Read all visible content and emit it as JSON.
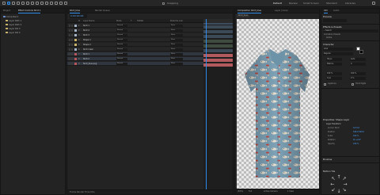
{
  "toolbar": {
    "tool_count": 14,
    "labels": [
      "Snapping",
      "Default",
      "Review",
      "Small Screen",
      "Standard",
      "Libraries"
    ],
    "current_workspace": "Default"
  },
  "project": {
    "tabs": [
      "Project",
      "Effect Controls Shirt 1"
    ],
    "items": [
      {
        "name": "Comp Rat 1",
        "type": "Composition",
        "color": "#6b8cc9"
      },
      {
        "name": "Layer Path 1",
        "type": "Shape",
        "color": "#c9b36b"
      },
      {
        "name": "Layer Path 2",
        "type": "Shape",
        "color": "#c9b36b"
      },
      {
        "name": "Layer Pat 3",
        "type": "Shape",
        "color": "#c9b36b"
      },
      {
        "name": "Layer Pat 4",
        "type": "Shape",
        "color": "#c9b36b"
      }
    ]
  },
  "timeline": {
    "tabs": [
      "Shirt_blue",
      "Render Queue"
    ],
    "timecode": "0:00:00:00",
    "headers": [
      "#",
      "Layer Name",
      "Mode",
      "T",
      "TrkMat",
      "Parent & Link"
    ],
    "layers": [
      {
        "num": "1",
        "name": "Shirt 1",
        "mode": "Normal",
        "parent": "None",
        "color": "#a3b4c8",
        "bar": "#3c4a57",
        "selected": false
      },
      {
        "num": "2",
        "name": "Shirt 2",
        "mode": "Normal",
        "parent": "None",
        "color": "#a3b4c8",
        "bar": "#3c4a57",
        "selected": false
      },
      {
        "num": "3",
        "name": "Shirt 3",
        "mode": "Normal",
        "parent": "None",
        "color": "#a3b4c8",
        "bar": "#3c4a57",
        "selected": false
      },
      {
        "num": "4",
        "name": "Shape 1",
        "mode": "Normal",
        "parent": "None",
        "color": "#c9b36b",
        "bar": "#3f4b3f",
        "selected": false
      },
      {
        "num": "5",
        "name": "Shape 2",
        "mode": "Normal",
        "parent": "None",
        "color": "#c9b36b",
        "bar": "#3f4b3f",
        "selected": false
      },
      {
        "num": "6",
        "name": "Shirt mask",
        "mode": "Normal",
        "parent": "None",
        "color": "#a3b4c8",
        "bar": "#3c4a57",
        "selected": false
      },
      {
        "num": "7",
        "name": "Shirt 1",
        "mode": "Normal",
        "parent": "None",
        "color": "#b7565a",
        "bar": "#b35a5e",
        "selected": true
      },
      {
        "num": "8",
        "name": "Shirt 2",
        "mode": "Normal",
        "parent": "None",
        "color": "#b7565a",
        "bar": "#b35a5e",
        "selected": true
      },
      {
        "num": "9",
        "name": "Shirt_blue.png",
        "mode": "Normal",
        "parent": "None",
        "color": "#b7565a",
        "bar": "#b35a5e",
        "selected": true
      }
    ],
    "footer": "Frame Render Time 0ms"
  },
  "viewer": {
    "tabs": [
      "Composition Shirt_blue",
      "Layer (none)"
    ],
    "path": "Shirt_blue",
    "footer": [
      "(50%)",
      "Full",
      "Active Camera",
      "1 View"
    ]
  },
  "properties": {
    "tabs": [
      "Info",
      "Audio"
    ],
    "preview_title": "Preview",
    "effects_title": "Effects & Presets",
    "search_placeholder": "Search",
    "presets_items": [
      "Animation Presets",
      "Adobe"
    ],
    "character_title": "Character",
    "font": "Arial",
    "font_style": "Regular",
    "font_size": "36 px",
    "leading": "Auto",
    "kerning": "Metrics",
    "tracking": "0",
    "scale_v": "100 %",
    "scale_h": "100 %",
    "baseline": "0 px",
    "tsume": "0 %",
    "ligatures_label": "Ligatures",
    "hindi_label": "Hindi Digits",
    "paragraph_title": "Properties: Shape Layer",
    "transform_title": "Layer Transform",
    "anchor_label": "Anchor Point",
    "anchor_value": "0.0 0.0",
    "position_label": "Position",
    "position_value": "540.0 540.0",
    "scale_label": "Scale",
    "scale_value": "100 %",
    "rotation_label": "Rotation",
    "rotation_value": "0x +0.0°",
    "opacity_label": "Opacity",
    "opacity_value": "100 %",
    "brushes_title": "Brushes",
    "align_title": "Motion Tile",
    "text_color": "#ffffff",
    "stroke_color": "#000000"
  },
  "colors": {
    "accent": "#2d8ceb",
    "panel_bg": "#232323",
    "selected_bar": "#b35a5e"
  }
}
